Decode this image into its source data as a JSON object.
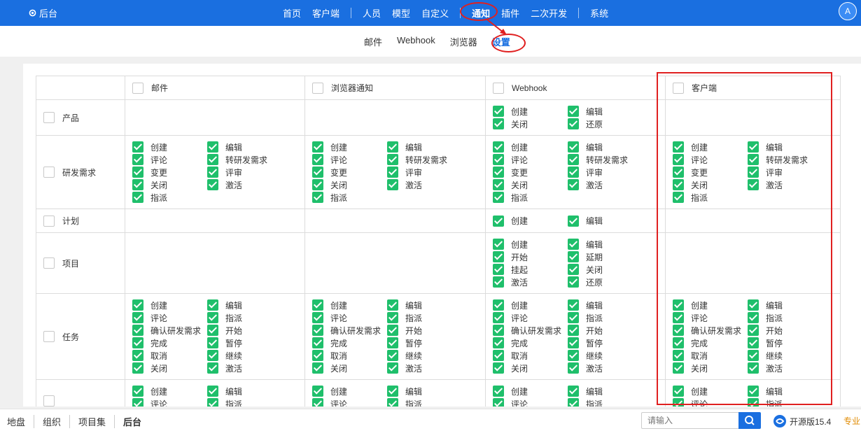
{
  "topbar": {
    "back_label": "后台",
    "nav": [
      "首页",
      "客户端",
      "人员",
      "模型",
      "自定义",
      "通知",
      "插件",
      "二次开发",
      "系统"
    ],
    "avatar": "A"
  },
  "subnav": [
    "邮件",
    "Webhook",
    "浏览器",
    "设置"
  ],
  "table": {
    "columns": [
      "邮件",
      "浏览器通知",
      "Webhook",
      "客户端"
    ],
    "rows": [
      {
        "name": "产品",
        "cells": [
          [],
          [],
          [
            "创建",
            "编辑",
            "关闭",
            "还原"
          ],
          []
        ]
      },
      {
        "name": "研发需求",
        "cells": [
          [
            "创建",
            "编辑",
            "评论",
            "转研发需求",
            "变更",
            "评审",
            "关闭",
            "激活",
            "指派"
          ],
          [
            "创建",
            "编辑",
            "评论",
            "转研发需求",
            "变更",
            "评审",
            "关闭",
            "激活",
            "指派"
          ],
          [
            "创建",
            "编辑",
            "评论",
            "转研发需求",
            "变更",
            "评审",
            "关闭",
            "激活",
            "指派"
          ],
          [
            "创建",
            "编辑",
            "评论",
            "转研发需求",
            "变更",
            "评审",
            "关闭",
            "激活",
            "指派"
          ]
        ]
      },
      {
        "name": "计划",
        "cells": [
          [],
          [],
          [
            "创建",
            "编辑"
          ],
          []
        ]
      },
      {
        "name": "项目",
        "cells": [
          [],
          [],
          [
            "创建",
            "编辑",
            "开始",
            "延期",
            "挂起",
            "关闭",
            "激活",
            "还原"
          ],
          []
        ]
      },
      {
        "name": "任务",
        "cells": [
          [
            "创建",
            "编辑",
            "评论",
            "指派",
            "确认研发需求",
            "开始",
            "完成",
            "暂停",
            "取消",
            "继续",
            "关闭",
            "激活"
          ],
          [
            "创建",
            "编辑",
            "评论",
            "指派",
            "确认研发需求",
            "开始",
            "完成",
            "暂停",
            "取消",
            "继续",
            "关闭",
            "激活"
          ],
          [
            "创建",
            "编辑",
            "评论",
            "指派",
            "确认研发需求",
            "开始",
            "完成",
            "暂停",
            "取消",
            "继续",
            "关闭",
            "激活"
          ],
          [
            "创建",
            "编辑",
            "评论",
            "指派",
            "确认研发需求",
            "开始",
            "完成",
            "暂停",
            "取消",
            "继续",
            "关闭",
            "激活"
          ]
        ]
      },
      {
        "name": "",
        "cells": [
          [
            "创建",
            "编辑",
            "评论",
            "指派"
          ],
          [
            "创建",
            "编辑",
            "评论",
            "指派"
          ],
          [
            "创建",
            "编辑",
            "评论",
            "指派"
          ],
          [
            "创建",
            "编辑",
            "评论",
            "指派"
          ]
        ]
      }
    ]
  },
  "bottombar": {
    "crumbs": [
      "地盘",
      "组织",
      "项目集",
      "后台"
    ],
    "search_placeholder": "请输入",
    "version": "开源版15.4",
    "brand": "专业"
  },
  "colors": {
    "primary": "#1a6fe0",
    "check": "#1fbf6b",
    "annotation": "#e02020"
  }
}
